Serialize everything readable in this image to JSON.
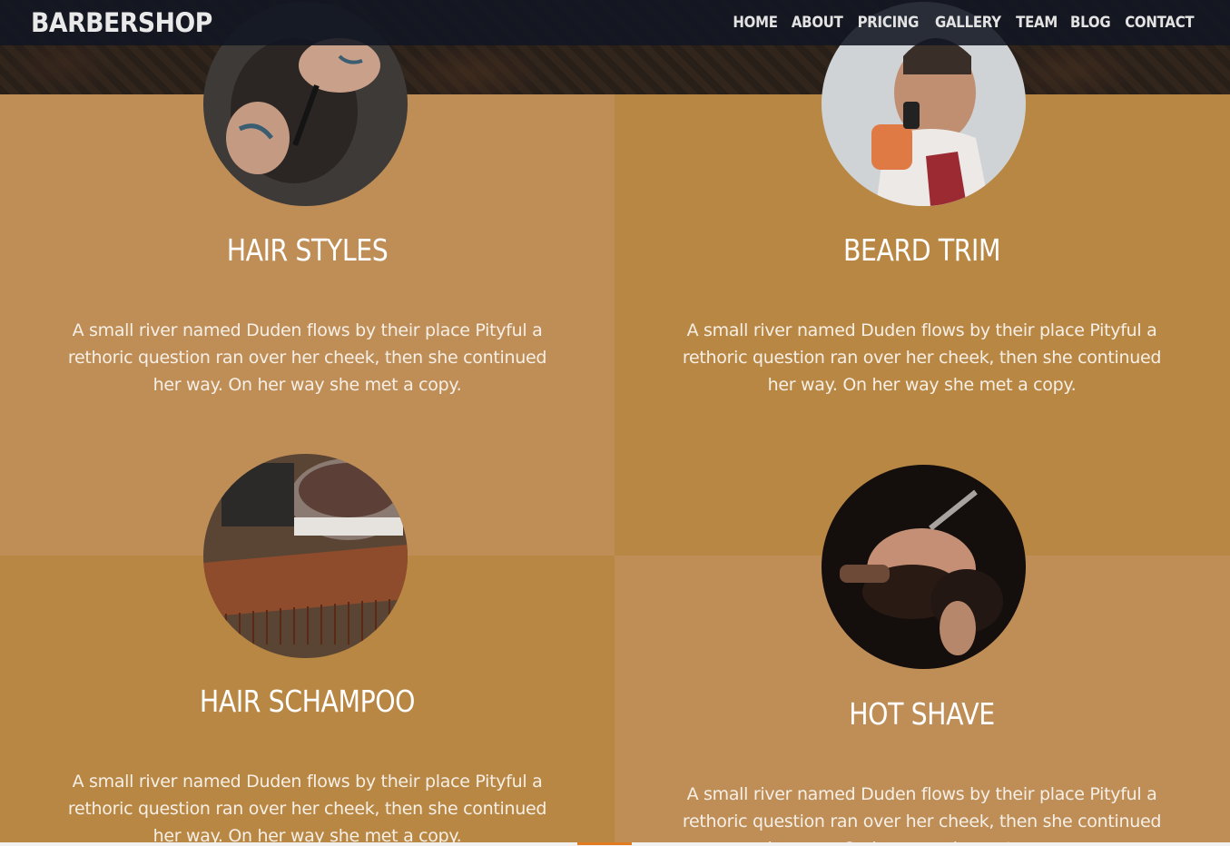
{
  "header": {
    "brand": "BARBERSHOP",
    "nav": [
      "HOME",
      "ABOUT",
      "PRICING",
      "GALLERY",
      "TEAM",
      "BLOG",
      "CONTACT"
    ]
  },
  "services": [
    {
      "title": "HAIR STYLES",
      "description": "A small river named Duden flows by their place Pityful a rethoric question ran over her cheek, then she continued her way. On her way she met a copy."
    },
    {
      "title": "BEARD TRIM",
      "description": "A small river named Duden flows by their place Pityful a rethoric question ran over her cheek, then she continued her way. On her way she met a copy."
    },
    {
      "title": "HAIR SCHAMPOO",
      "description": "A small river named Duden flows by their place Pityful a rethoric question ran over her cheek, then she continued her way. On her way she met a copy."
    },
    {
      "title": "HOT SHAVE",
      "description": "A small river named Duden flows by their place Pityful a rethoric question ran over her cheek, then she continued her way. On her way she met a copy."
    }
  ],
  "colors": {
    "header_bg": "#111622",
    "cell_light": "#bf8e57",
    "cell_dark": "#b98744",
    "text": "#ffffff"
  }
}
